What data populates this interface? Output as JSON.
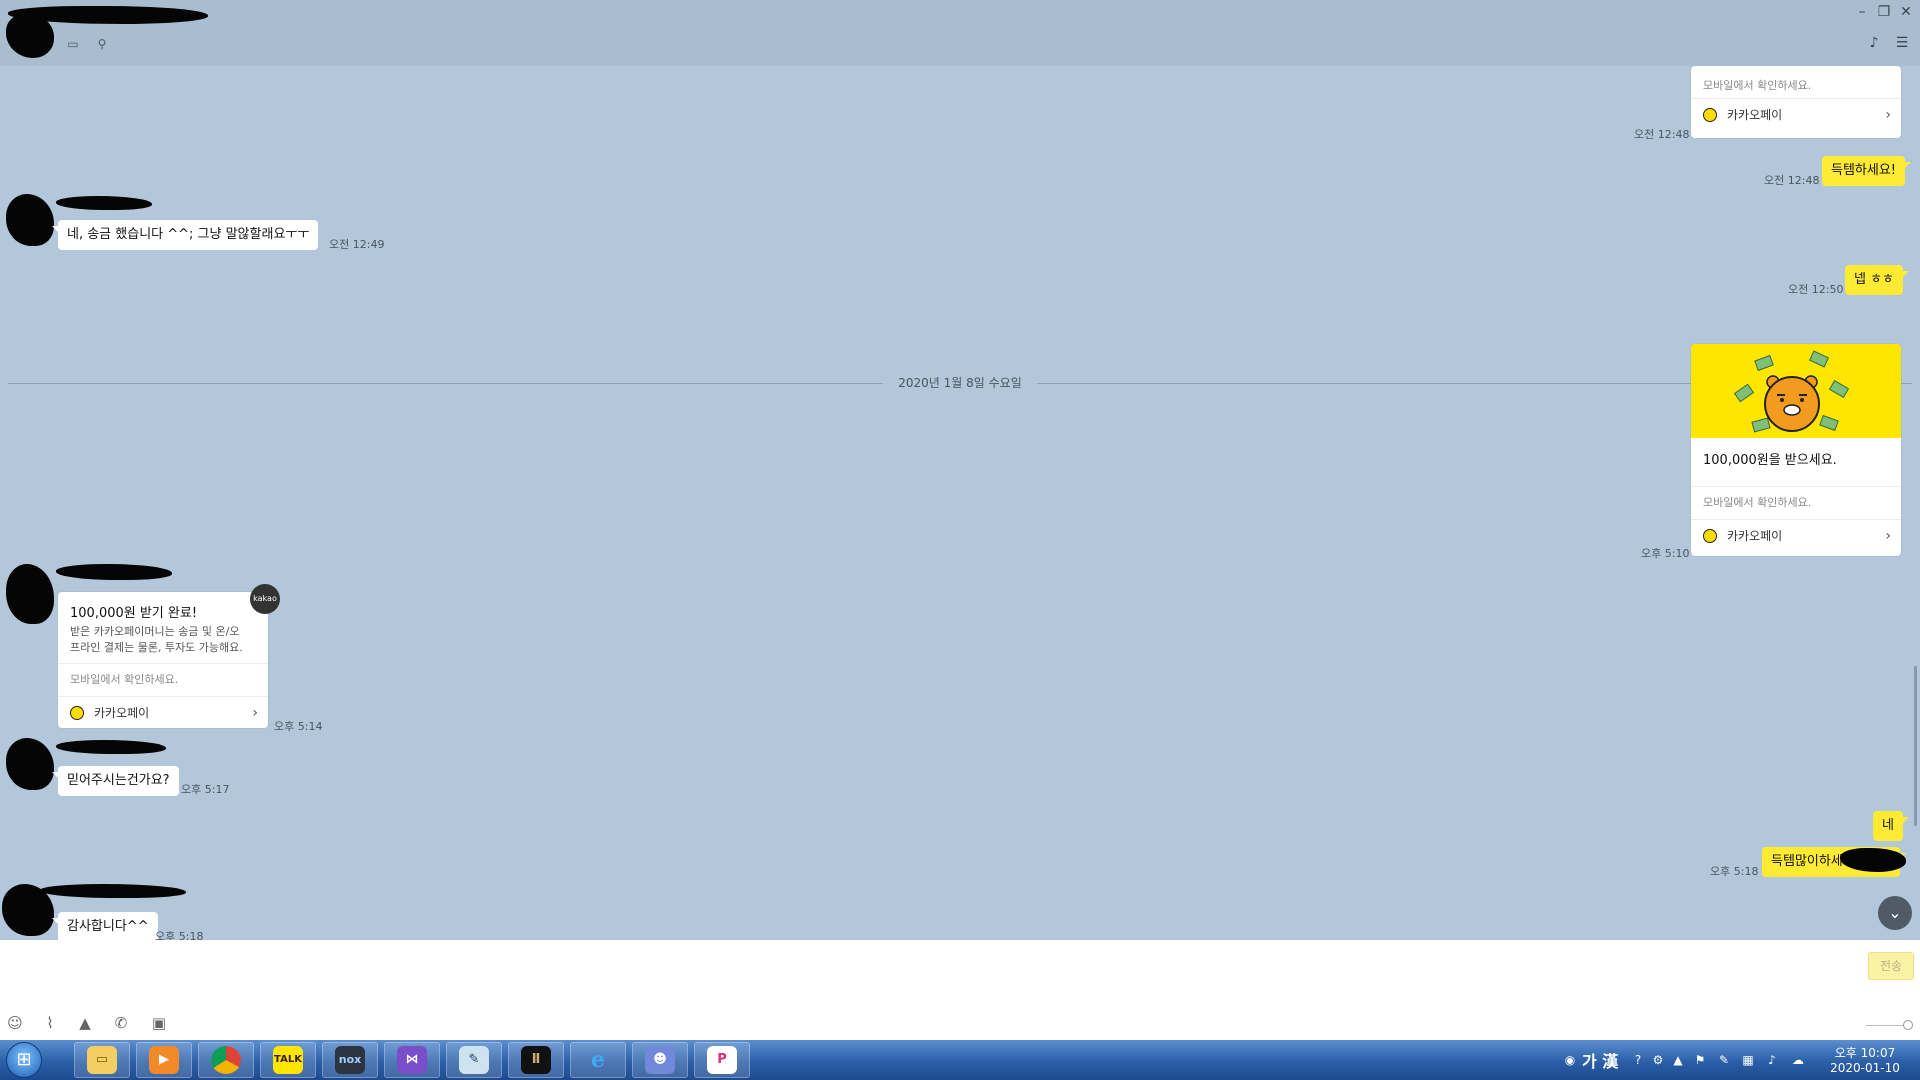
{
  "chat": {
    "date_divider": "2020년 1월 8일 수요일",
    "top_card": {
      "check_mobile": "모바일에서 확인하세요.",
      "kakaopay": "카카오페이",
      "time": "오전 12:48"
    },
    "my_msg1": {
      "text": "득템하세요!",
      "time": "오전 12:48"
    },
    "their_msg1": {
      "text": "네,  송금 했습니다   ^^;  그냥 말않할래요ㅜㅜ",
      "time": "오전 12:49"
    },
    "my_msg2": {
      "text": "넵 ㅎㅎ",
      "time": "오전 12:50"
    },
    "money_card": {
      "title": "100,000원을 받으세요.",
      "check_mobile": "모바일에서 확인하세요.",
      "kakaopay": "카카오페이",
      "time": "오후 5:10"
    },
    "receipt_card": {
      "badge": "kakao",
      "title": "100,000원 받기 완료!",
      "desc1": "받은 카카오페이머니는 송금 및 온/오",
      "desc2": "프라인 결제는 물론, 투자도 가능해요.",
      "check_mobile": "모바일에서 확인하세요.",
      "kakaopay": "카카오페이",
      "time": "오후 5:14"
    },
    "their_msg2": {
      "text": "믿어주시는건가요?",
      "time": "오후 5:17"
    },
    "my_msg3": {
      "text": "네"
    },
    "my_msg4": {
      "text": "득템많이하세요",
      "time": "오후 5:18"
    },
    "their_msg3": {
      "text": "감사합니다^^",
      "time": "오후 5:18"
    }
  },
  "input": {
    "send_label": "전송"
  },
  "taskbar": {
    "apps": [
      "explorer",
      "media-player",
      "chrome",
      "kakaotalk",
      "nox",
      "visual-studio",
      "notepad",
      "game",
      "internet-explorer",
      "discord",
      "picpick"
    ],
    "talk_label": "TALK",
    "nox_label": "nox",
    "ime_label": "가 漢",
    "clock_time": "오후 10:07",
    "clock_date": "2020-01-10"
  },
  "colors": {
    "chat_bg": "#b2c7da",
    "my_bubble": "#ffeb33",
    "their_bubble": "#ffffff",
    "taskbar": "#2b5fa8"
  },
  "icons": [
    "minimize-icon",
    "restore-icon",
    "close-icon",
    "folder-icon",
    "search-icon",
    "bell-icon",
    "menu-icon",
    "emoji-icon",
    "attach-icon",
    "image-icon",
    "phone-icon",
    "calendar-icon",
    "scroll-down-icon"
  ]
}
